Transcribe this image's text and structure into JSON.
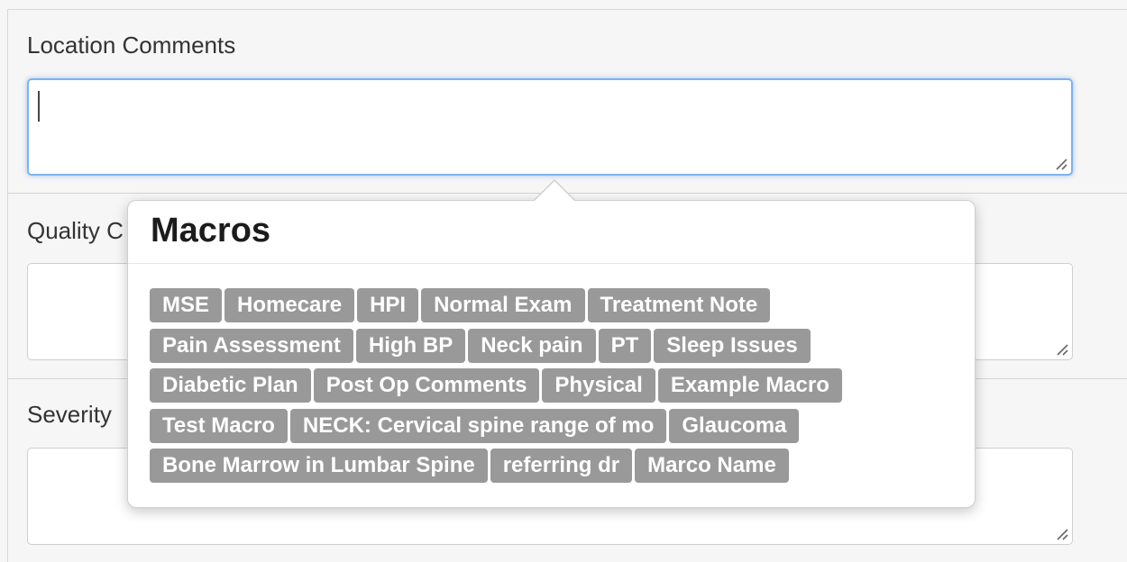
{
  "fields": [
    {
      "label": "Location Comments",
      "value": ""
    },
    {
      "label": "Quality C",
      "value": ""
    },
    {
      "label": "Severity",
      "value": ""
    }
  ],
  "popover": {
    "title": "Macros",
    "macro_rows": [
      [
        "MSE",
        "Homecare",
        "HPI",
        "Normal Exam",
        "Treatment Note"
      ],
      [
        "Pain Assessment",
        "High BP",
        "Neck pain",
        "PT",
        "Sleep Issues"
      ],
      [
        "Diabetic Plan",
        "Post Op Comments",
        "Physical",
        "Example Macro"
      ],
      [
        "Test Macro",
        "NECK: Cervical spine range of mo",
        "Glaucoma"
      ],
      [
        "Bone Marrow in Lumbar Spine",
        "referring dr",
        "Marco Name"
      ]
    ]
  },
  "colors": {
    "macro_bg": "#999999",
    "focus_border": "#7db3f2"
  }
}
